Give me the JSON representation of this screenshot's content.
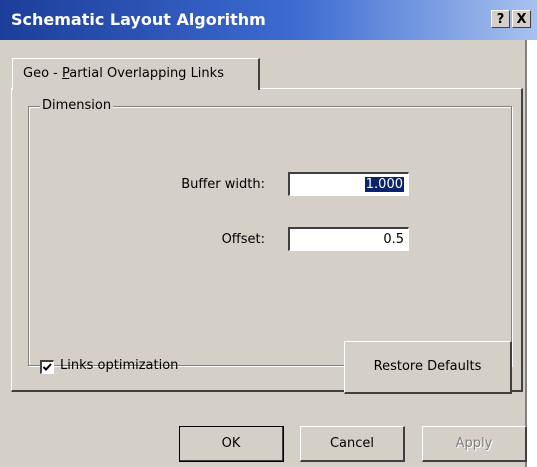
{
  "window": {
    "title": "Schematic Layout Algorithm",
    "help_button": "?",
    "close_button": "X"
  },
  "tabs": [
    {
      "label_prefix": "Geo - ",
      "label_accel": "P",
      "label_rest": "artial Overlapping Links",
      "active": true
    }
  ],
  "group": {
    "label": "Dimension",
    "fields": [
      {
        "label": "Buffer width:",
        "value": "1.000",
        "selected": true
      },
      {
        "label": "Offset:",
        "value": "0.5",
        "selected": false
      }
    ]
  },
  "links_optimization": {
    "label": "Links optimization",
    "checked": true
  },
  "buttons": {
    "restore_defaults": "Restore Defaults",
    "ok": "OK",
    "cancel": "Cancel",
    "apply": "Apply"
  }
}
